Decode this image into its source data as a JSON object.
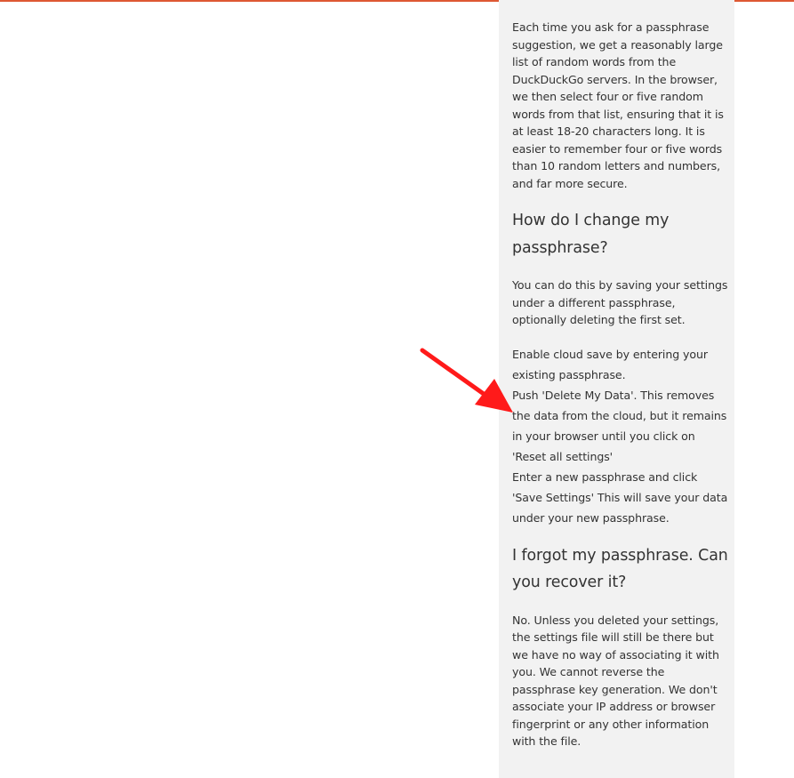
{
  "accent_color": "#de5833",
  "annotation_arrow_color": "#ff1a1a",
  "faq": {
    "intro_paragraph": "Each time you ask for a passphrase suggestion, we get a reasonably large list of random words from the DuckDuckGo servers. In the browser, we then select four or five random words from that list, ensuring that it is at least 18-20 characters long. It is easier to remember four or five words than 10 random letters and numbers, and far more secure.",
    "change_heading": "How do I change my passphrase?",
    "change_paragraph": "You can do this by saving your settings under a different passphrase, optionally deleting the first set.",
    "change_steps": [
      "Enable cloud save by entering your existing passphrase.",
      "Push 'Delete My Data'. This removes the data from the cloud, but it remains in your browser until you click on 'Reset all settings'",
      "Enter a new passphrase and click 'Save Settings' This will save your data under your new passphrase."
    ],
    "forgot_heading": "I forgot my passphrase. Can you recover it?",
    "forgot_paragraph": "No. Unless you deleted your settings, the settings file will still be there but we have no way of associating it with you. We cannot reverse the passphrase key generation. We don't associate your IP address or browser fingerprint or any other information with the file."
  }
}
